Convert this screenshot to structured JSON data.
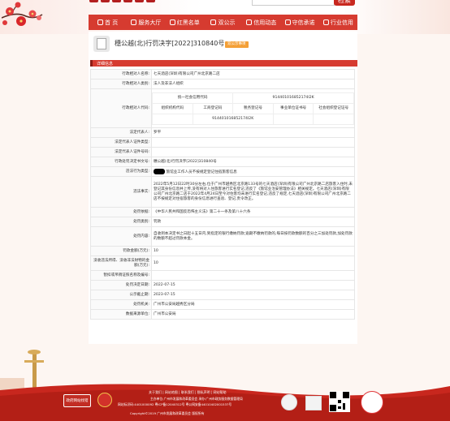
{
  "header": {
    "search_button": "检索"
  },
  "nav": {
    "items": [
      {
        "label": "首 页",
        "icon": "home-icon"
      },
      {
        "label": "服务大厅",
        "icon": "service-icon"
      },
      {
        "label": "红黑名单",
        "icon": "list-icon"
      },
      {
        "label": "双公示",
        "icon": "publicity-icon"
      },
      {
        "label": "信用动态",
        "icon": "news-icon"
      },
      {
        "label": "守信承诺",
        "icon": "promise-icon"
      },
      {
        "label": "行业信用",
        "icon": "industry-icon"
      }
    ]
  },
  "record": {
    "title": "穗公越(北)行罚决字[2022]310840号",
    "badge": "双公示事项",
    "section": "详细信息",
    "rows": {
      "name_label": "行政相对人名称:",
      "name": "七天酒店(深圳)有限公司广州北京路二店",
      "type_label": "行政相对人类别:",
      "type": "法人及非法人组织",
      "code_label": "行政相对人代码:",
      "uscc_header": "统一社会信用代码",
      "uscc": "914401016852174I2K",
      "org_code": "组织机构代码",
      "biz_reg": "工商登记码",
      "tax_reg": "税务登记号",
      "inst_code": "事业单位证书号",
      "social_code": "社会组织登记证号",
      "biz_reg_value": "914401016852174I2K",
      "legal_label": "法定代表人:",
      "legal": "罗平",
      "legal_id_type_label": "法定代表人证件类型:",
      "legal_id_type": "",
      "legal_id_no_label": "法定代表人证件号码:",
      "legal_id_no": "",
      "doc_no_label": "行政处罚决定书文号:",
      "doc_no": "穗公越(北)行罚决字[2022]310840号",
      "violation_type_label": "违法行为类型:",
      "violation_type": "旅馆业工作人员不按规定登记住宿旅客信息",
      "facts_label": "违法事实:",
      "facts": "2022年5月12日22时30分左右,位于广州市越秀区北京路133号的七天酒店(深圳)有限公司广州北京路二店旅客入住时,未登记其身份信息并上传,没有将对入住旅客进行实名登记,违反了《旅馆业治安管理办法》相关规定。七天酒店(深圳)有限公司广州北京路二店于2022年4月24日至今对住客均未进行实名登记,违反了规定,七天酒店(深圳)有限公司广州北京路二店不按规定对住宿旅客的身份信息进行查验、登记,责令改正。",
      "basis_label": "处罚依据:",
      "basis": "《中华人民共和国反恐怖主义法》第二十一条及第八十六条",
      "category_label": "处罚类别:",
      "category": "罚款",
      "content_label": "处罚内容:",
      "content": "自收到本决定书之日起十五日内,到指定的银行缴纳罚款;逾期不缴纳罚款的,每日按罚款数额的百分之三加处罚款,加处罚款的数额不超过罚款本金。",
      "fine_label": "罚款金额(万元):",
      "fine": "10",
      "confiscation_label": "没收违法所得、没收非法财物的金额(万元):",
      "confiscation": "10",
      "license_label": "暂扣或吊销证照名称及编号:",
      "license": "",
      "decision_date_label": "处罚决定日期:",
      "decision_date": "2022-07-15",
      "deadline_label": "公示截止期:",
      "deadline": "2023-07-15",
      "authority_label": "处罚机关:",
      "authority": "广州市公安局越秀区分局",
      "source_label": "数据来源单位:",
      "source": "广州市公安局"
    }
  },
  "footer": {
    "links": "关于我们 | 网站地图 | 联系我们 | 隐私声明 | 网站帮助",
    "host": "主办单位:广州市发展和改革委员会 承办:广州市政务服务数据管理局",
    "icp": "网站标识码:4401000092 粤ICP备12040312号 粤公网安备44010402001537号",
    "copyright": "Copyright©2019 广州市发展和改革委员会 版权所有",
    "gov_badge": "政府网站找错",
    "colors": {
      "red": "#d63b30",
      "dark_red": "#8d1c15",
      "badge": "#f4a037"
    }
  }
}
